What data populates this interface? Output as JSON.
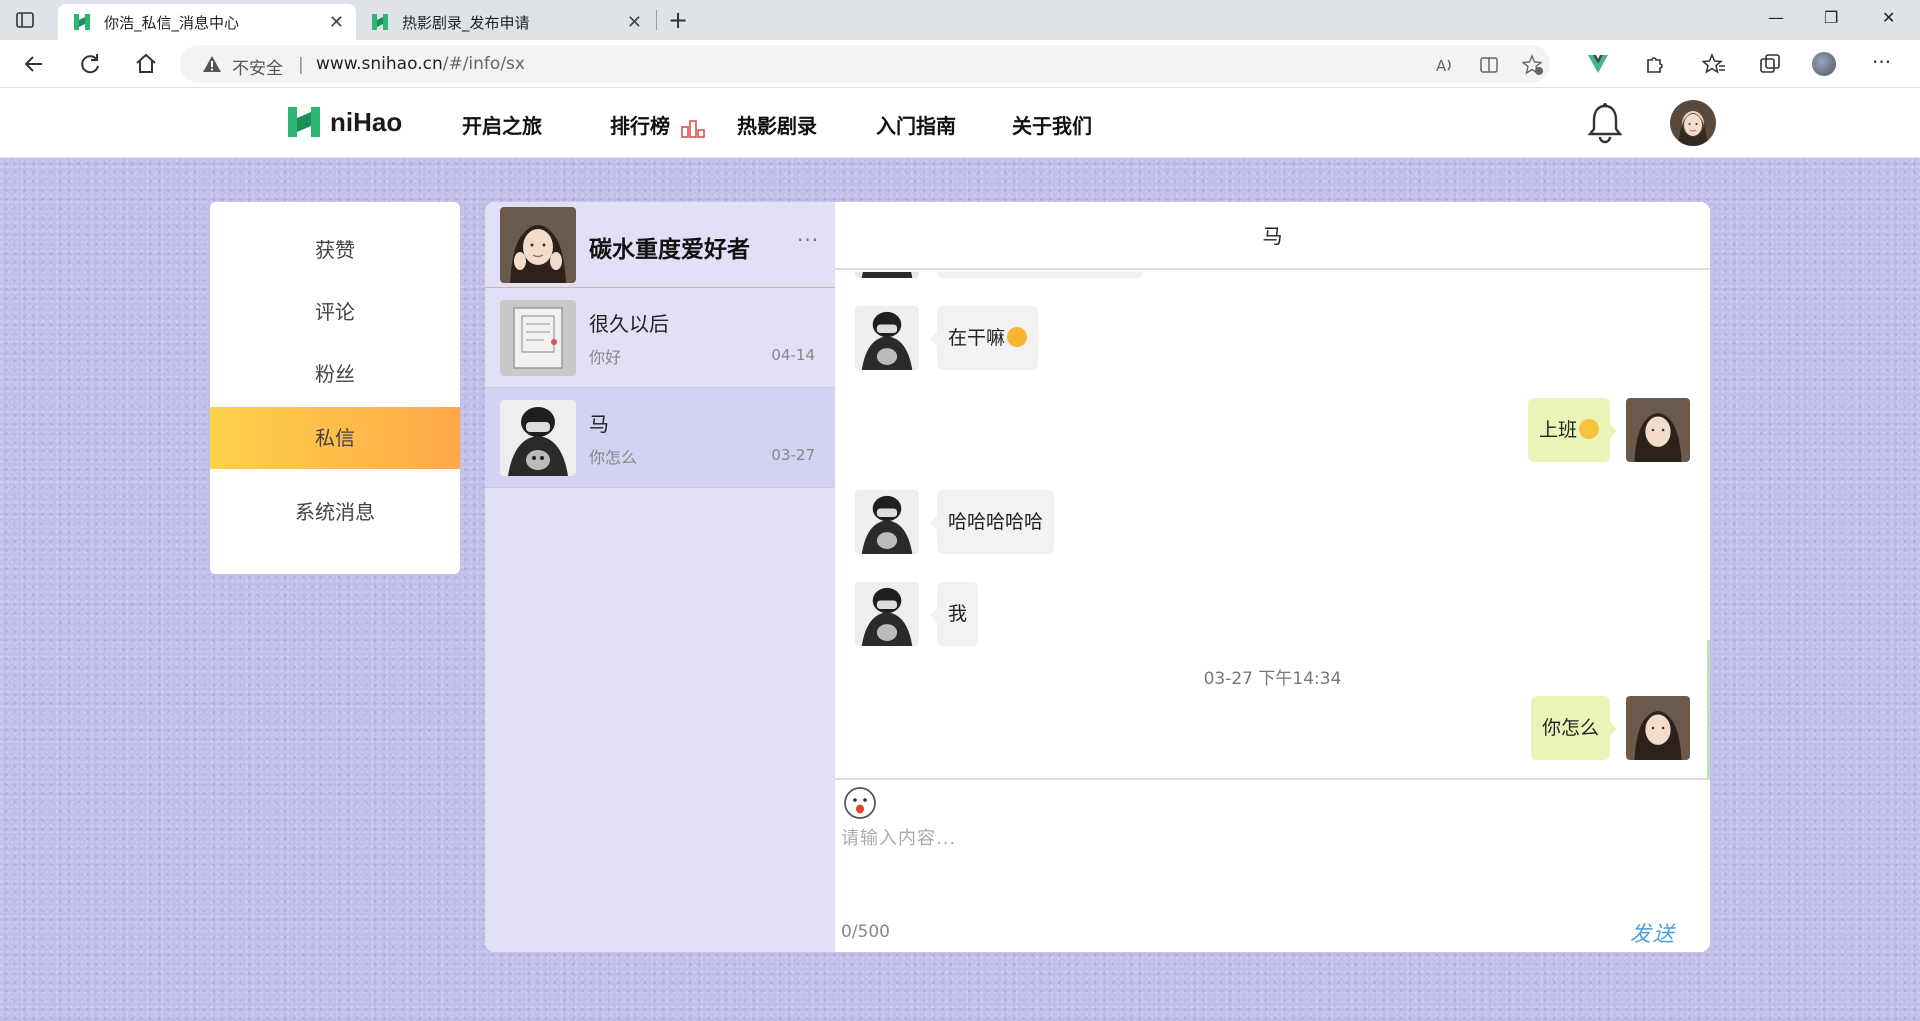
{
  "browser": {
    "tabs": [
      {
        "title": "你浩_私信_消息中心",
        "active": true
      },
      {
        "title": "热影剧录_发布申请",
        "active": false
      }
    ],
    "address": {
      "security_label": "不安全",
      "divider": "|",
      "host": "www.snihao.cn",
      "path": "/#/info/sx"
    }
  },
  "site": {
    "logo_text": "niHao",
    "nav": [
      "开启之旅",
      "排行榜",
      "热影剧录",
      "入门指南",
      "关于我们"
    ],
    "colors": {
      "brand": "#2bb673",
      "menu_active_start": "#ffd24a",
      "menu_active_end": "#ffa84a",
      "send": "#4a9fd8",
      "bubble_self": "#e8f5b6",
      "bubble_other": "#f2f2f2",
      "conv_bg": "#e1e0f6"
    }
  },
  "side_menu": {
    "items": [
      "获赞",
      "评论",
      "粉丝",
      "私信",
      "系统消息"
    ],
    "active_index": 3
  },
  "me": {
    "name": "碳水重度爱好者",
    "more": "···"
  },
  "conversations": [
    {
      "name": "很久以后",
      "preview": "你好",
      "date": "04-14"
    },
    {
      "name": "马",
      "preview": "你怎么",
      "date": "03-27",
      "active": true
    }
  ],
  "chat": {
    "title": "马",
    "messages": [
      {
        "from": "other",
        "text": "在干嘛"
      },
      {
        "from": "self",
        "text": "上班"
      },
      {
        "from": "other",
        "text": "哈哈哈哈哈"
      },
      {
        "from": "other",
        "text": "我"
      },
      {
        "from": "self",
        "text": "你怎么"
      }
    ],
    "timestamp": "03-27 下午14:34"
  },
  "composer": {
    "placeholder": "请输入内容...",
    "count": "0/500",
    "send_label": "发送"
  }
}
